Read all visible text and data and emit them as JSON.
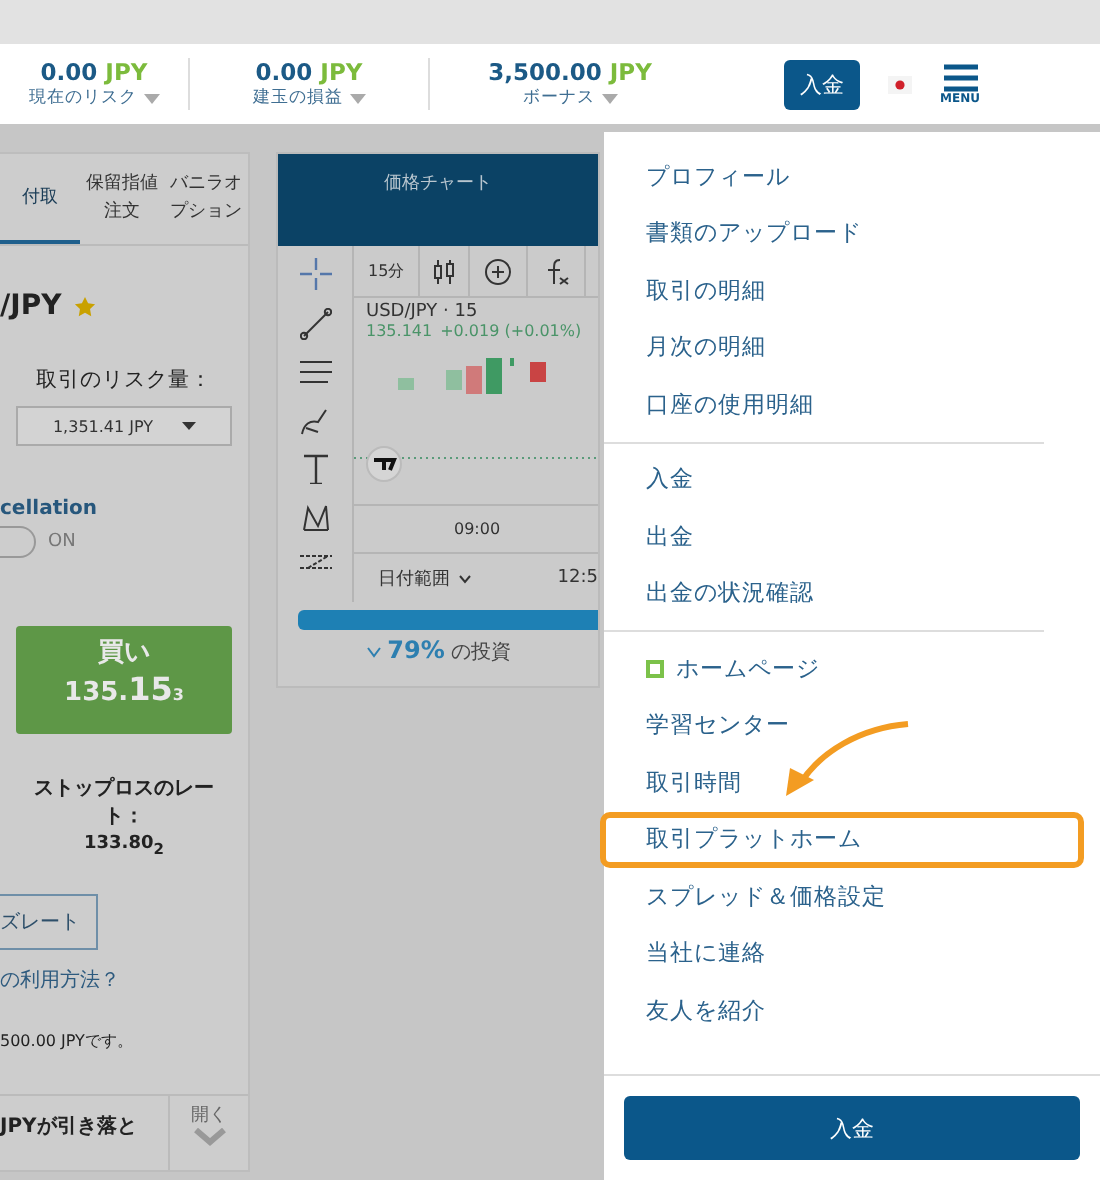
{
  "header": {
    "stats": [
      {
        "value": "0.00",
        "currency": "JPY",
        "label": "現在のリスク"
      },
      {
        "value": "0.00",
        "currency": "JPY",
        "label": "建玉の損益"
      },
      {
        "value": "3,500.00",
        "currency": "JPY",
        "label": "ボーナス"
      }
    ],
    "deposit_button": "入金",
    "menu_label": "MENU"
  },
  "trade_panel": {
    "tabs": [
      {
        "label": "付取",
        "selected": true
      },
      {
        "label": "保留指値注文",
        "selected": false
      },
      {
        "label": "バニラオプション",
        "selected": false
      }
    ],
    "pair": "/JPY",
    "favorite": true,
    "risk_label": "取引のリスク量：",
    "risk_value": "1,351.41 JPY",
    "toggle_label": "cellation",
    "toggle_state": "ON",
    "toggle_on": false,
    "buy_label": "買い",
    "buy_price": "135.**15**$_{3}$",
    "stop_loss_label": "ストップロスのレート：",
    "stop_loss_value": "133.80$_{2}$",
    "rate_button": "ズレート",
    "help_link": "の利用方法？",
    "note": "500.00 JPYです。",
    "footer_text": "JPYが引き落と",
    "expand_label": "開く"
  },
  "chart_panel": {
    "title": "価格チャート",
    "interval": "15分",
    "symbol": "USD/JPY · 15",
    "quote_price": "135.141",
    "quote_change": "+0.019 (+0.01%)",
    "time_label": "09:00",
    "date_range": "日付範囲",
    "time_cut": "12:5",
    "progress": {
      "level": 1
    },
    "sentiment_value": "79%",
    "sentiment_text": "の投資"
  },
  "menu": {
    "groups": [
      [
        {
          "label": "プロフィール",
          "highlighted": false
        },
        {
          "label": "書類のアップロード",
          "highlighted": false
        },
        {
          "label": "取引の明細",
          "highlighted": false
        },
        {
          "label": "月次の明細",
          "highlighted": false
        },
        {
          "label": "口座の使用明細",
          "highlighted": false
        }
      ],
      [
        {
          "label": "入金",
          "highlighted": false
        },
        {
          "label": "出金",
          "highlighted": false
        },
        {
          "label": "出金の状況確認",
          "highlighted": false
        }
      ],
      [
        {
          "label": "ホームページ",
          "highlighted": false,
          "kind": "icon"
        },
        {
          "label": "学習センター",
          "highlighted": false
        },
        {
          "label": "取引時間",
          "highlighted": false
        },
        {
          "label": "取引プラットホーム",
          "highlighted": true
        },
        {
          "label": "スプレッド＆価格設定",
          "highlighted": false
        },
        {
          "label": "当社に連絡",
          "highlighted": false
        },
        {
          "label": "友人を紹介",
          "highlighted": false
        }
      ]
    ],
    "footer_button": "入金"
  }
}
